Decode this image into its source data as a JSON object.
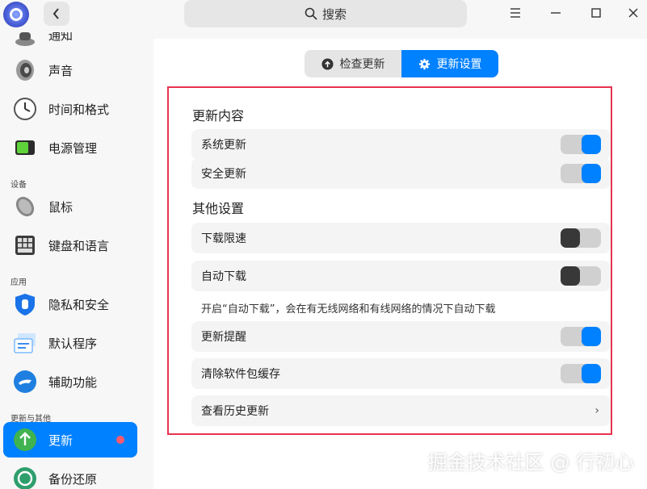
{
  "titlebar": {
    "search_label": "搜索",
    "icons": {
      "logo": "app-logo",
      "back": "chevron-left-icon",
      "search": "search-icon",
      "menu": "hamburger-menu-icon",
      "minimize": "minimize-icon",
      "maximize": "maximize-icon",
      "close": "close-icon"
    }
  },
  "sidebar": {
    "items": [
      {
        "label": "通知",
        "icon": "notification-icon"
      },
      {
        "label": "声音",
        "icon": "speaker-icon"
      },
      {
        "label": "时间和格式",
        "icon": "clock-icon"
      },
      {
        "label": "电源管理",
        "icon": "battery-icon"
      },
      {
        "label": "鼠标",
        "icon": "mouse-icon"
      },
      {
        "label": "键盘和语言",
        "icon": "keyboard-icon"
      },
      {
        "label": "隐私和安全",
        "icon": "shield-hand-icon"
      },
      {
        "label": "默认程序",
        "icon": "default-apps-icon"
      },
      {
        "label": "辅助功能",
        "icon": "accessibility-icon"
      },
      {
        "label": "更新",
        "icon": "update-arrow-icon",
        "active": true,
        "badge": true
      },
      {
        "label": "备份还原",
        "icon": "backup-icon"
      }
    ],
    "categories": {
      "devices": "设备",
      "apps": "应用",
      "update_other": "更新与其他"
    }
  },
  "tabs": {
    "check_label": "检查更新",
    "settings_label": "更新设置",
    "active": "更新设置"
  },
  "content": {
    "update_content_title": "更新内容",
    "system_update": "系统更新",
    "security_update": "安全更新",
    "other_title": "其他设置",
    "download_limit": "下载限速",
    "auto_download": "自动下载",
    "auto_download_hint": "开启“自动下载”，会在有无线网络和有线网络的情况下自动下载",
    "update_reminder": "更新提醒",
    "clear_cache": "清除软件包缓存",
    "history": "查看历史更新"
  },
  "toggles": {
    "system_update": true,
    "security_update": true,
    "download_limit": false,
    "auto_download": false,
    "update_reminder": true,
    "clear_cache": true
  },
  "colors": {
    "accent": "#0081ff",
    "highlight_border": "#e8334f",
    "badge": "#ff5a6e"
  },
  "watermark": "掘金技术社区 @ 行初心"
}
